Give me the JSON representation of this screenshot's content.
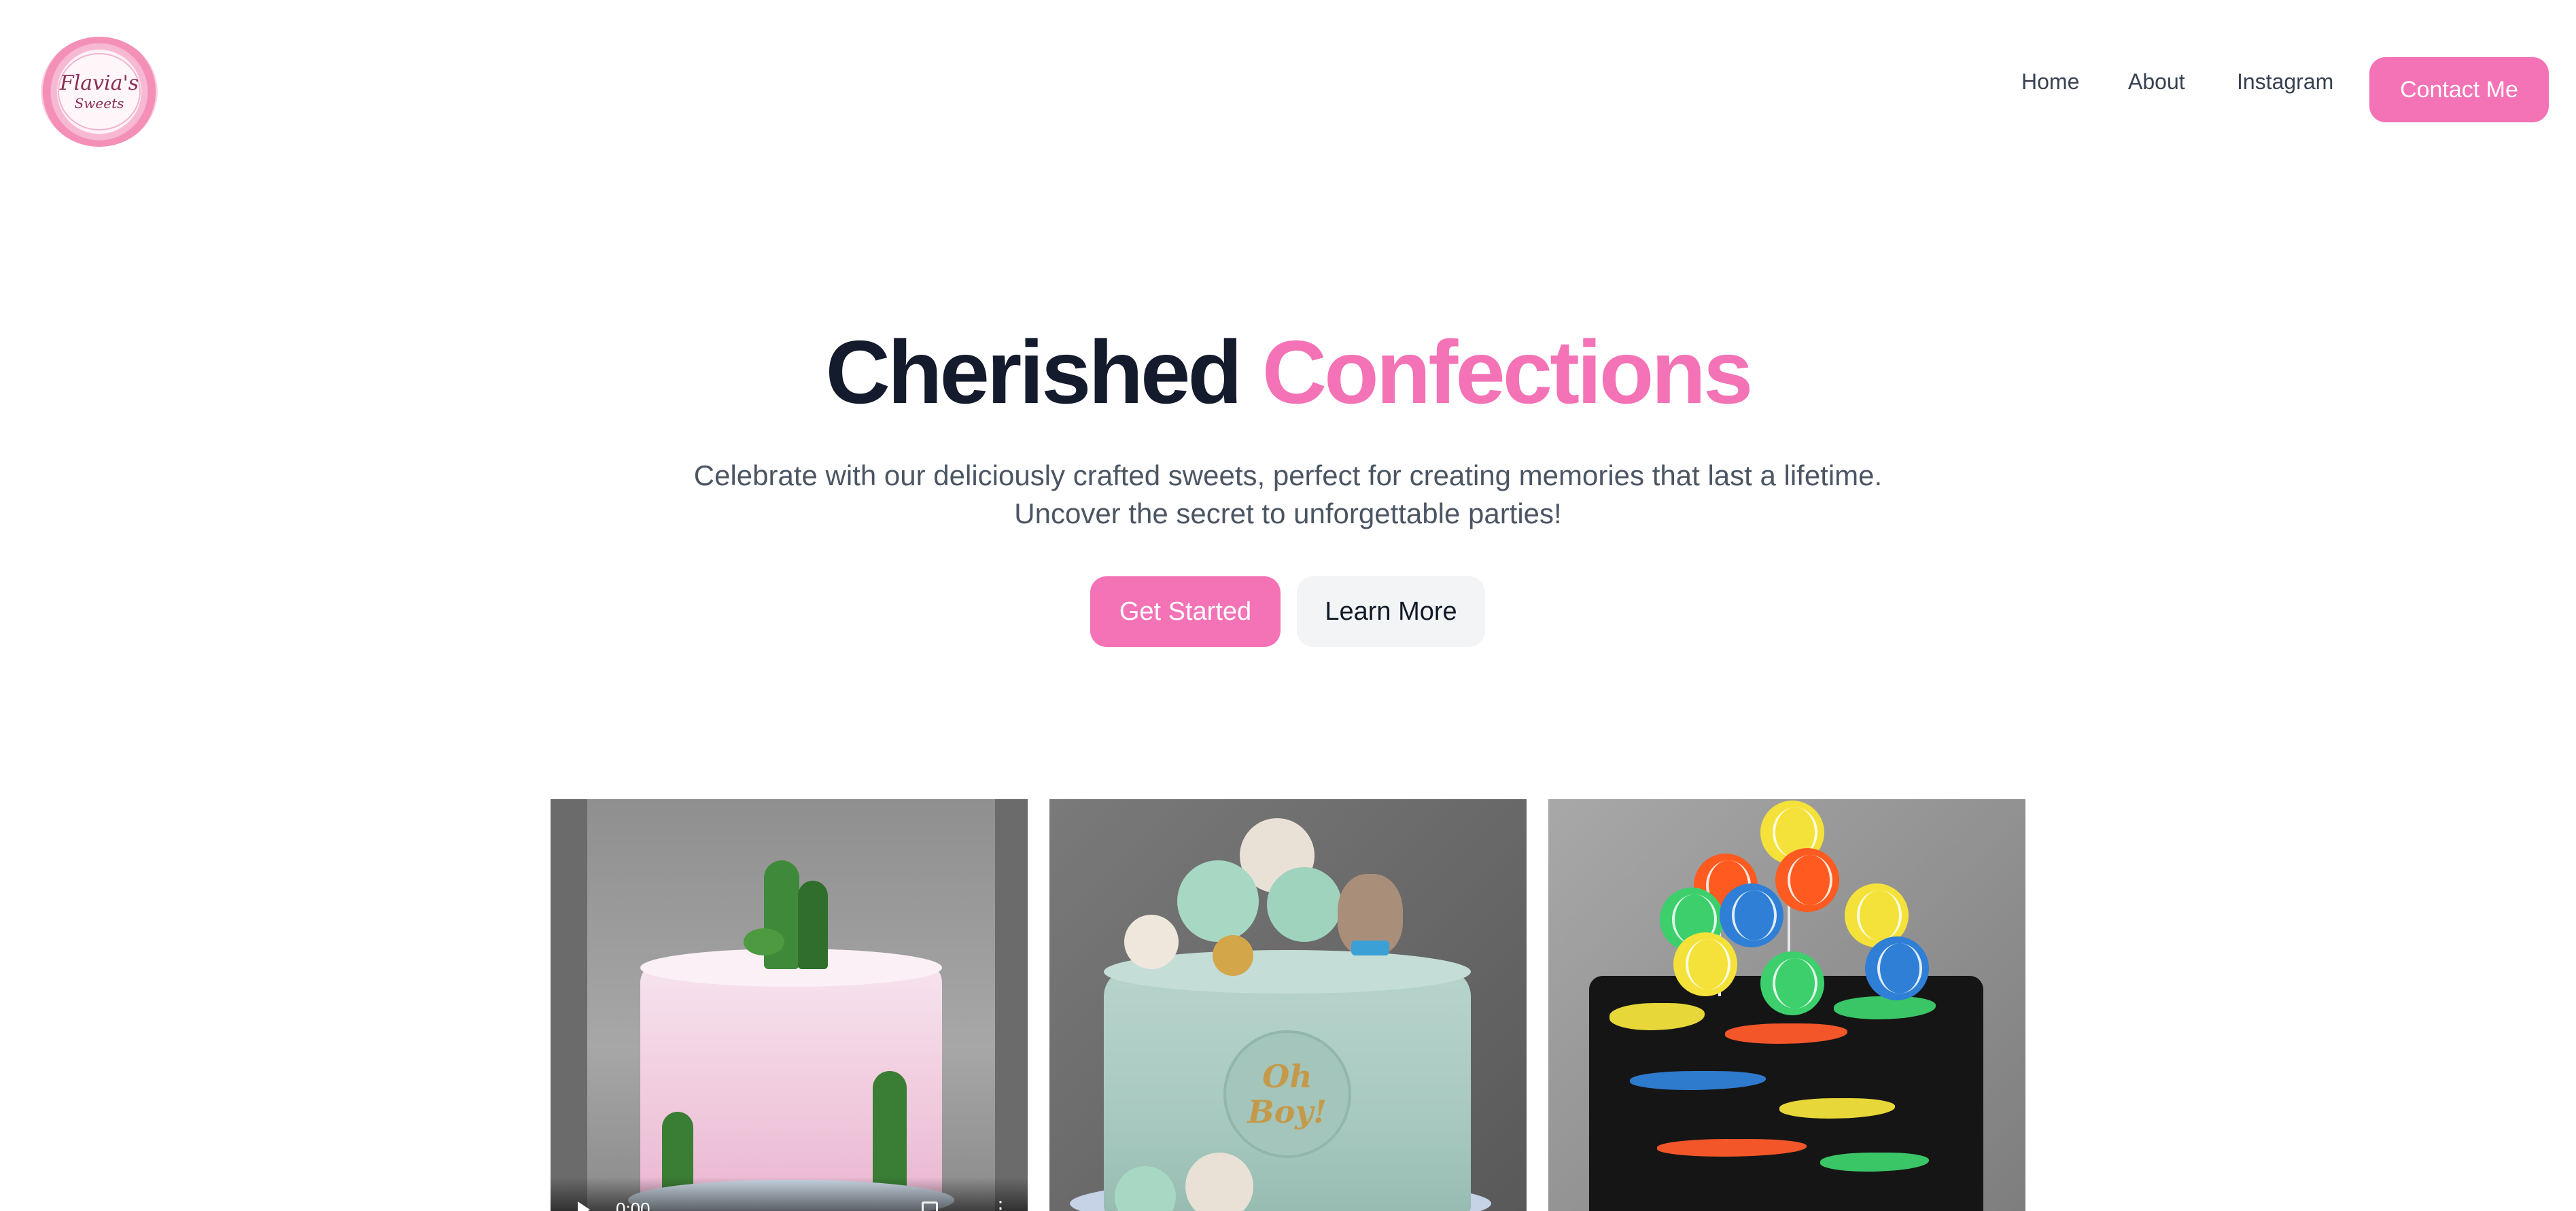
{
  "header": {
    "logo": {
      "name": "Flavia's",
      "sub": "Sweets"
    },
    "nav": {
      "home": "Home",
      "about": "About",
      "instagram": "Instagram"
    },
    "contact_label": "Contact Me"
  },
  "hero": {
    "title_dark": "Cherished",
    "title_accent": "Confections",
    "subtitle_line1": "Celebrate with our deliciously crafted sweets, perfect for creating memories that last a lifetime.",
    "subtitle_line2": "Uncover the secret to unforgettable parties!",
    "primary_button": "Get Started",
    "secondary_button": "Learn More"
  },
  "gallery": {
    "video_time": "0:00",
    "plaque_line1": "Oh",
    "plaque_line2": "Boy!"
  },
  "colors": {
    "accent": "#f472b6",
    "heading": "#141b2d",
    "body_text": "#4b5563",
    "secondary_button_bg": "#f3f4f6"
  },
  "icons": {
    "play": "play-icon",
    "fullscreen": "fullscreen-icon",
    "more": "more-icon"
  }
}
